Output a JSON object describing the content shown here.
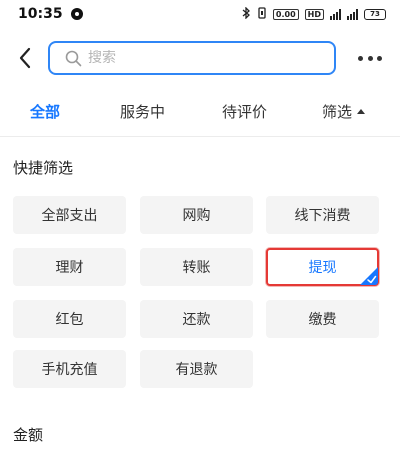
{
  "status_bar": {
    "time": "10:35",
    "icons": [
      "bluetooth-icon",
      "vibrate-icon",
      "data-speed-icon",
      "hd-icon",
      "signal-icon",
      "signal-icon",
      "battery-icon"
    ],
    "data_speed": "0.00",
    "hd": "HD",
    "battery": "73"
  },
  "search": {
    "placeholder": "搜索",
    "value": ""
  },
  "tabs": [
    {
      "label": "全部",
      "active": true
    },
    {
      "label": "服务中",
      "active": false
    },
    {
      "label": "待评价",
      "active": false
    },
    {
      "label": "筛选",
      "active": false
    }
  ],
  "quick_filter": {
    "title": "快捷筛选",
    "chips": [
      {
        "label": "全部支出",
        "selected": false
      },
      {
        "label": "网购",
        "selected": false
      },
      {
        "label": "线下消费",
        "selected": false
      },
      {
        "label": "理财",
        "selected": false
      },
      {
        "label": "转账",
        "selected": false
      },
      {
        "label": "提现",
        "selected": true
      },
      {
        "label": "红包",
        "selected": false
      },
      {
        "label": "还款",
        "selected": false
      },
      {
        "label": "缴费",
        "selected": false
      },
      {
        "label": "手机充值",
        "selected": false
      },
      {
        "label": "有退款",
        "selected": false
      }
    ]
  },
  "amount": {
    "title": "金额"
  },
  "colors": {
    "accent": "#1677ff",
    "search_border": "#2f86f6",
    "selected_border": "#e53935",
    "chip_bg": "#f4f4f4"
  }
}
